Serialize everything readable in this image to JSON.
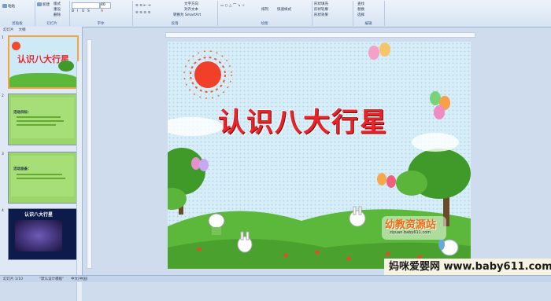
{
  "ribbon": {
    "groups": [
      {
        "label": "剪贴板"
      },
      {
        "label": "幻灯片"
      },
      {
        "label": "字体"
      },
      {
        "label": "段落"
      },
      {
        "label": "绘图"
      },
      {
        "label": "编辑"
      }
    ],
    "items": {
      "paste": "粘贴",
      "new_slide": "新建",
      "layout": "版式",
      "reset": "重设",
      "delete": "删除",
      "text_direction": "文字方向",
      "align_text": "对齐文本",
      "smartart": "转换为 SmartArt",
      "arrange": "排列",
      "quick_styles": "快速样式",
      "shape_fill": "形状填充",
      "shape_outline": "形状轮廓",
      "shape_effects": "形状效果",
      "find": "查找",
      "replace": "替换",
      "select": "选择",
      "font_size": "40"
    }
  },
  "panel": {
    "tabs": [
      "幻灯片",
      "大纲"
    ],
    "slides": [
      {
        "num": "1",
        "title": "认识八大行星"
      },
      {
        "num": "2",
        "heading": "活动目标："
      },
      {
        "num": "3",
        "heading": "活动准备："
      },
      {
        "num": "4",
        "title": "认识八大行星"
      }
    ]
  },
  "slide": {
    "title": "认识八大行星",
    "logo_text": "幼教资源站",
    "logo_url": "ziyuan.baby611.com"
  },
  "status": {
    "slide_info": "幻灯片 1/10",
    "theme": "\"默认设计模板\"",
    "language": "中文(中国)"
  },
  "watermark": "妈咪爱婴网 www.baby611.com",
  "colors": {
    "title": "#e8232a",
    "sky": "#d7eef8",
    "grass": "#5cb83a",
    "sun": "#f0402a"
  }
}
